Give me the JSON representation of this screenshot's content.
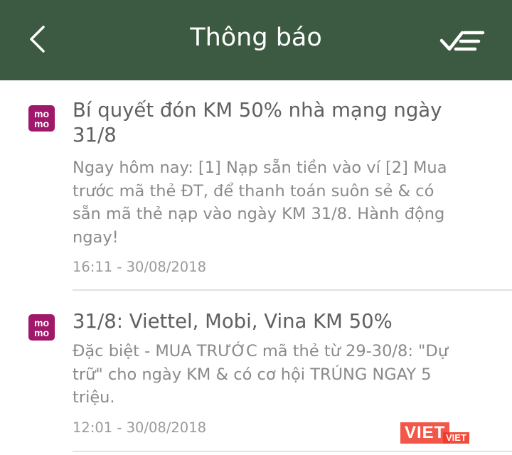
{
  "header": {
    "title": "Thông báo",
    "back_icon": "chevron-left-icon",
    "mark_all_read_icon": "check-list-icon",
    "background_color": "#3c5a41"
  },
  "notifications": [
    {
      "logo_line1": "mo",
      "logo_line2": "mo",
      "title_line1": "Bí quyết đón KM 50% nhà mạng ngày",
      "title_line2": "31/8",
      "body_line1": "Ngay hôm nay: [1] Nạp sẵn tiền vào ví [2] Mua",
      "body_line2": "trước mã thẻ ĐT, để thanh toán suôn sẻ & có",
      "body_line3": "sẵn mã thẻ nạp vào ngày KM 31/8. Hành động",
      "body_line4": "ngay!",
      "time": "16:11 - 30/08/2018"
    },
    {
      "logo_line1": "mo",
      "logo_line2": "mo",
      "title_line1": "31/8: Viettel, Mobi, Vina KM 50%",
      "body_line1": "Đặc biệt - MUA TRƯỚC mã thẻ từ 29-30/8: \"Dự",
      "body_line2": "trữ\" cho ngày KM & có cơ hội TRÚNG NGAY 5",
      "body_line3": "triệu.",
      "time": "12:01 - 30/08/2018"
    }
  ],
  "watermark": {
    "main": "VIET",
    "sub": "VIET"
  },
  "colors": {
    "brand_logo": "#a0186a",
    "title_text": "#606060",
    "body_text": "#8a8a8a"
  }
}
